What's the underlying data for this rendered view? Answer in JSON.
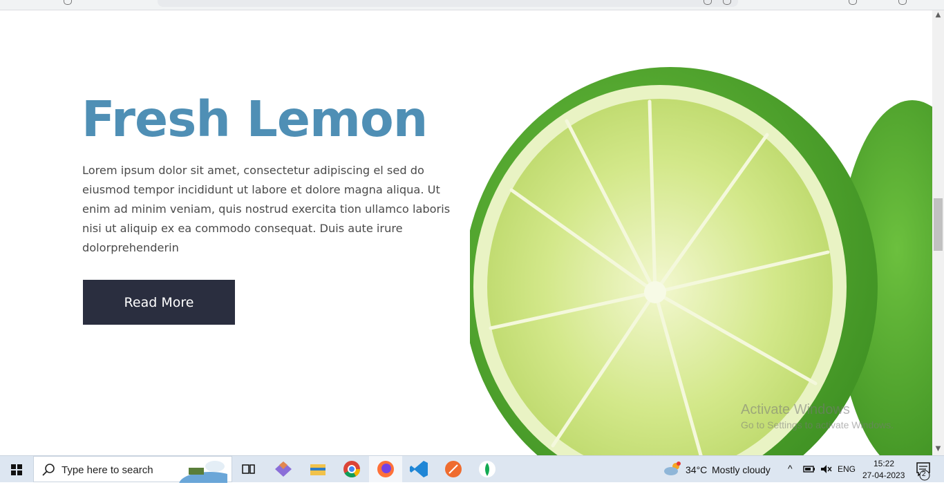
{
  "hero": {
    "title": "Fresh Lemon",
    "description": "Lorem ipsum dolor sit amet, consectetur adipiscing el sed do eiusmod tempor incididunt ut labore et dolore magna aliqua. Ut enim ad minim veniam, quis nostrud exercita tion ullamco laboris nisi ut aliquip ex ea commodo consequat. Duis aute irure dolorprehenderin",
    "button_label": "Read More"
  },
  "watermark": {
    "title": "Activate Windows",
    "subtitle": "Go to Settings to activate Windows."
  },
  "colors": {
    "title": "#4f8fb5",
    "button_bg": "#2a2e3f",
    "lime_rind": "#4ca42a",
    "lime_flesh": "#c8e07a"
  },
  "taskbar": {
    "search_placeholder": "Type here to search",
    "apps": [
      "windows-start-icon",
      "task-view-icon",
      "git-icon",
      "file-explorer-icon",
      "chrome-icon",
      "firefox-icon",
      "vscode-icon",
      "postman-icon",
      "mongodb-icon"
    ],
    "weather": {
      "temp": "34°C",
      "condition": "Mostly cloudy"
    },
    "language": "ENG",
    "time": "15:22",
    "date": "27-04-2023",
    "notification_count": "2"
  }
}
